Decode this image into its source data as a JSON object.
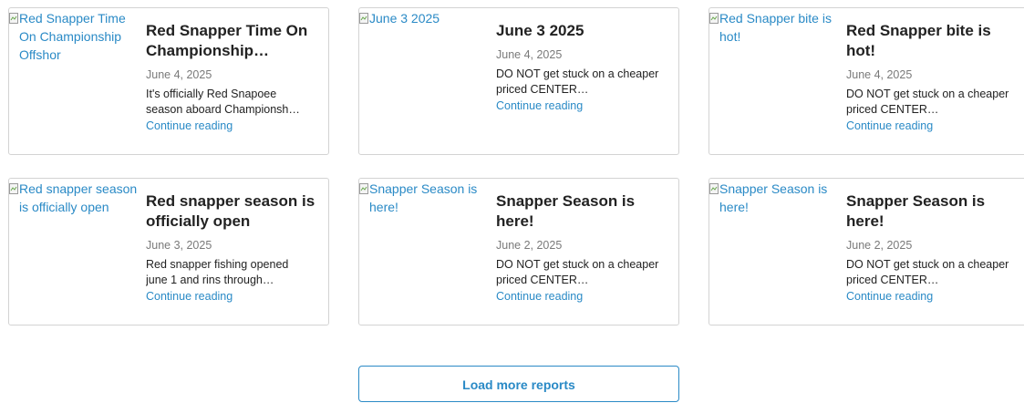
{
  "reports": [
    {
      "image_alt": "Red Snapper Time On Championship Offshor",
      "title": "Red Snapper Time On Championship…",
      "date": "June 4, 2025",
      "excerpt": "It's officially Red Snapoee season aboard Championsh…",
      "link": "Continue reading"
    },
    {
      "image_alt": "June 3 2025",
      "title": "June 3 2025",
      "date": "June 4, 2025",
      "excerpt": "DO NOT get stuck on a cheaper priced CENTER…",
      "link": "Continue reading"
    },
    {
      "image_alt": "Red Snapper bite is hot!",
      "title": "Red Snapper bite is hot!",
      "date": "June 4, 2025",
      "excerpt": "DO NOT get stuck on a cheaper priced CENTER…",
      "link": "Continue reading"
    },
    {
      "image_alt": "Red snapper season is officially open",
      "title": "Red snapper season is officially open",
      "date": "June 3, 2025",
      "excerpt": "Red snapper fishing opened june 1 and rins through…",
      "link": "Continue reading"
    },
    {
      "image_alt": "Snapper Season is here!",
      "title": "Snapper Season is here!",
      "date": "June 2, 2025",
      "excerpt": "DO NOT get stuck on a cheaper priced CENTER…",
      "link": "Continue reading"
    },
    {
      "image_alt": "Snapper Season is here!",
      "title": "Snapper Season is here!",
      "date": "June 2, 2025",
      "excerpt": "DO NOT get stuck on a cheaper priced CENTER…",
      "link": "Continue reading"
    }
  ],
  "load_more_label": "Load more reports",
  "icons": {
    "broken_image": "broken-image-icon"
  },
  "colors": {
    "link": "#2a8ac6",
    "title": "#222222",
    "date": "#7a7a7a",
    "border": "#d3d3d3"
  }
}
